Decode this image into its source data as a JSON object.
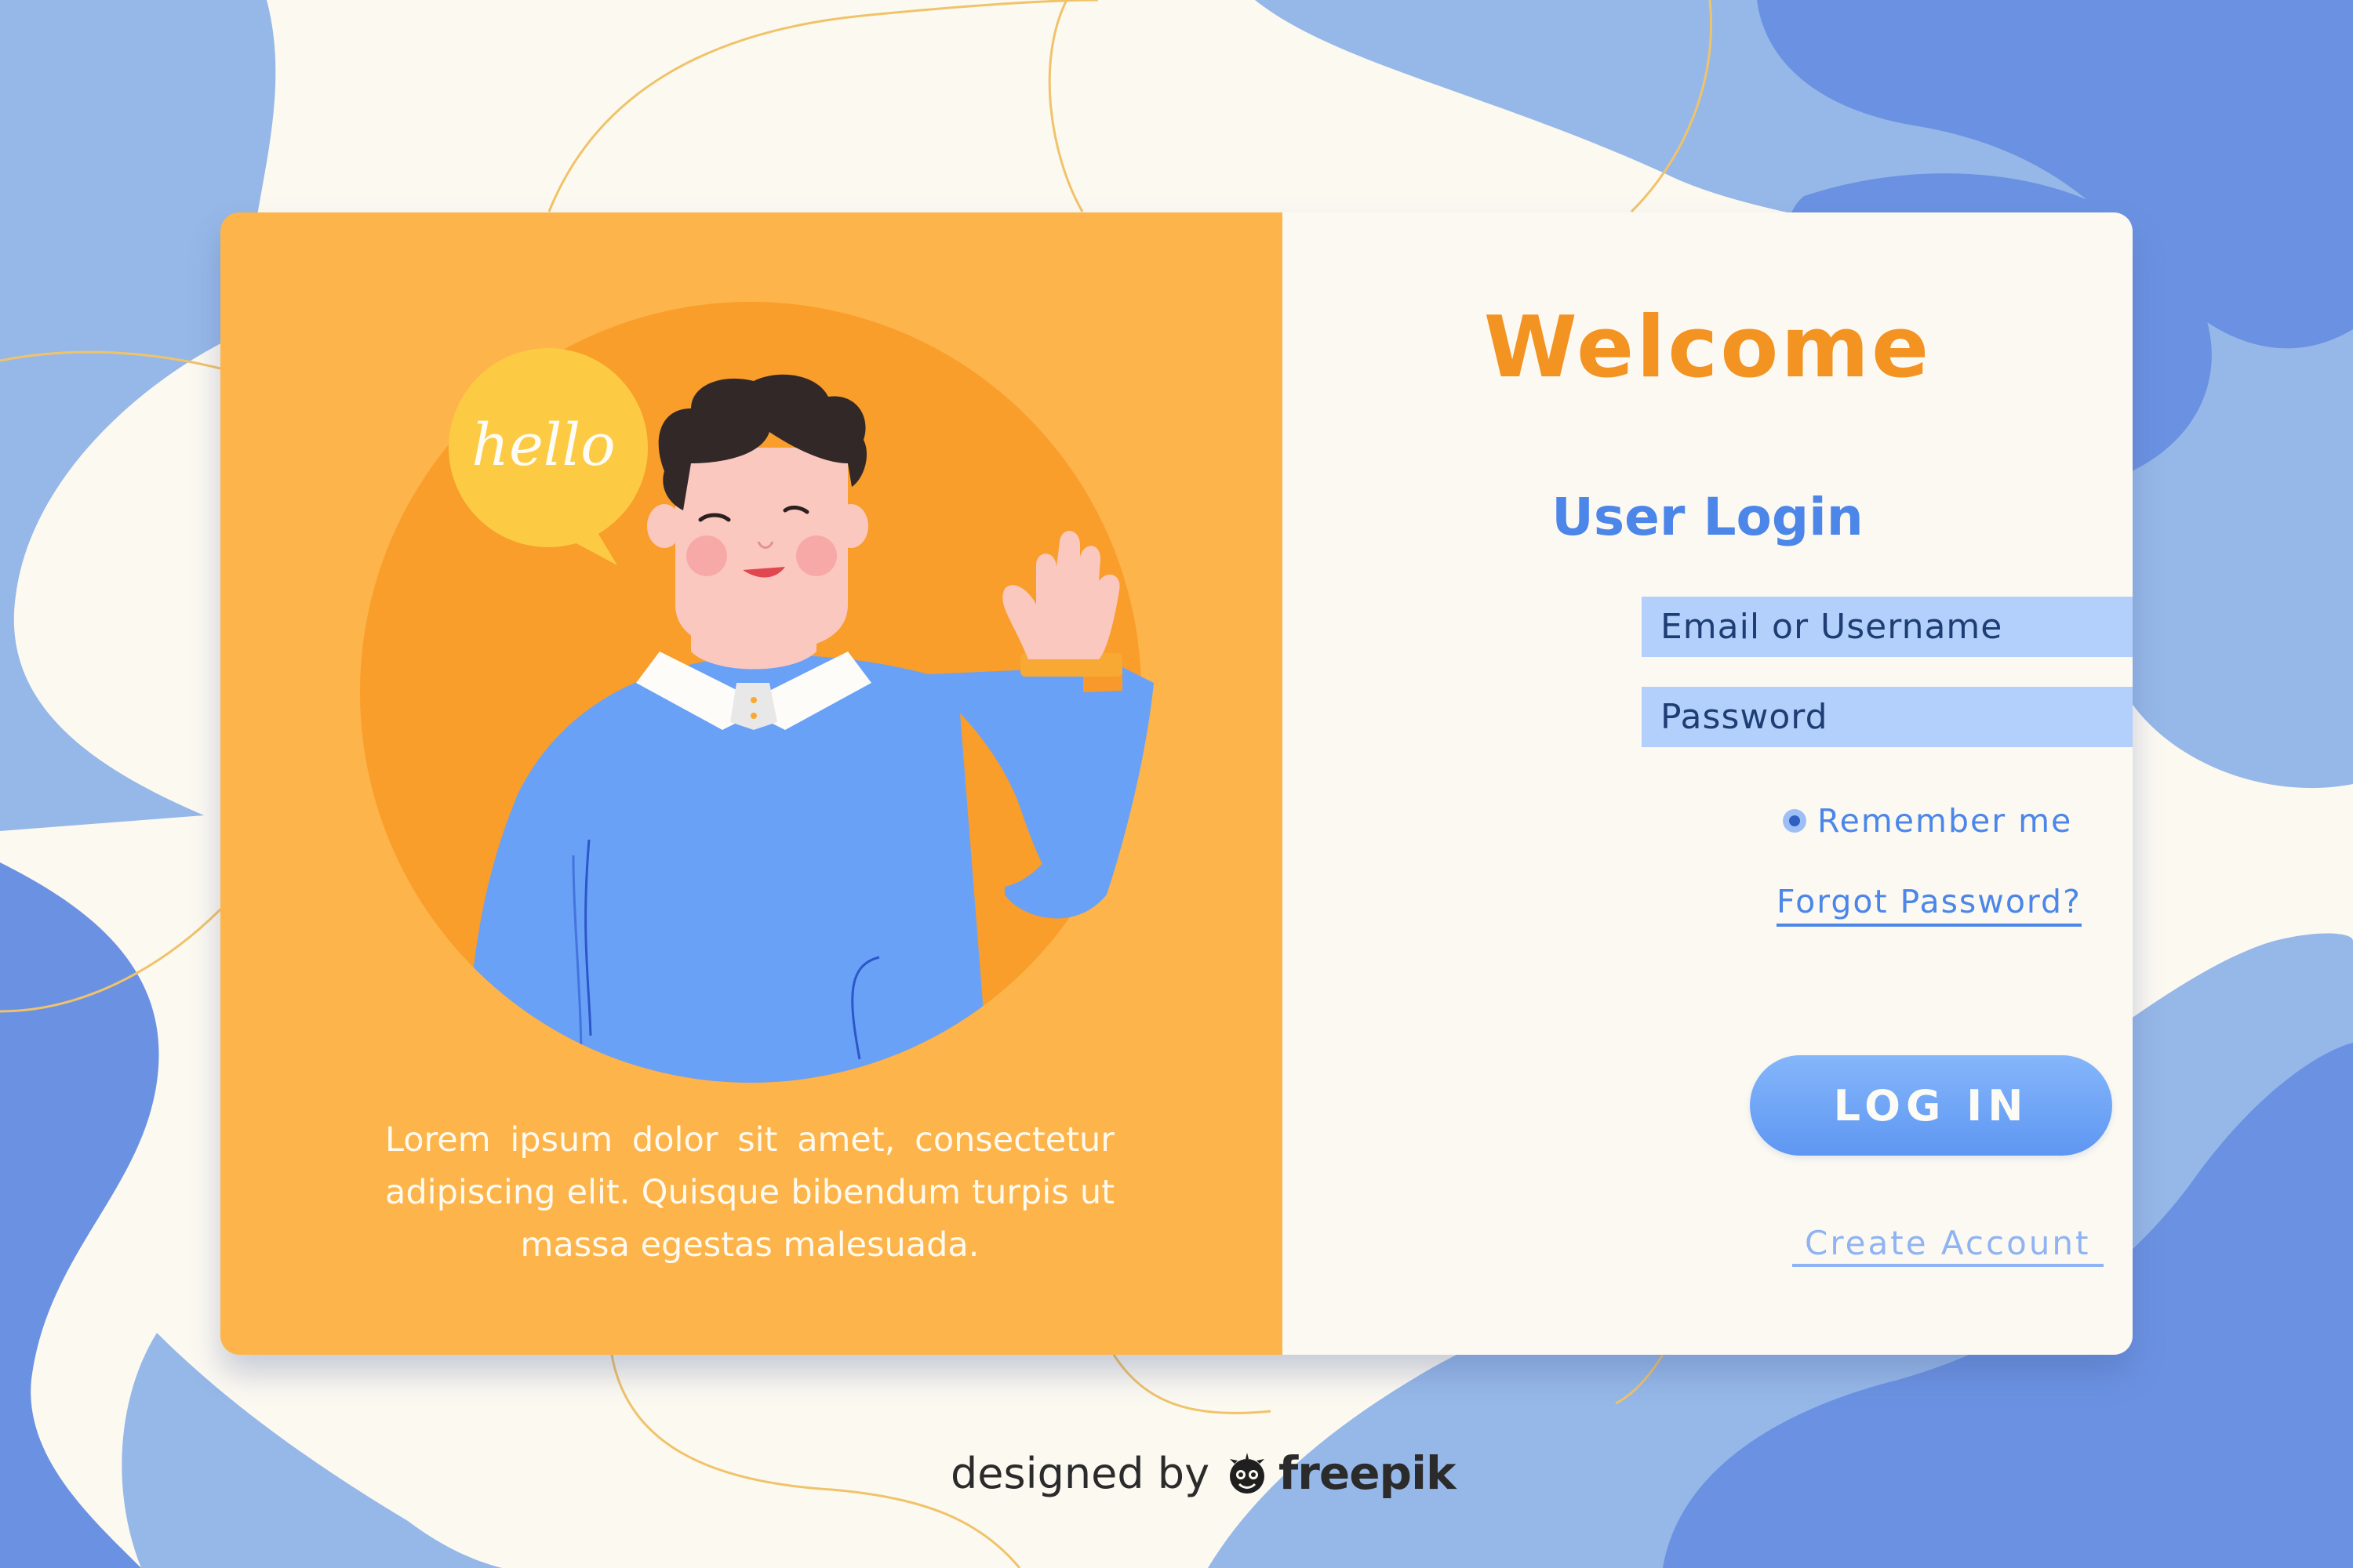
{
  "welcome": {
    "title": "Welcome",
    "subtitle": "User Login"
  },
  "form": {
    "email_placeholder": "Email or Username",
    "password_placeholder": "Password",
    "remember_label": "Remember me",
    "remember_checked": true,
    "forgot_label": "Forgot Password?",
    "login_label": "LOG IN",
    "create_label": "Create Account"
  },
  "illustration": {
    "speech_bubble": "hello",
    "description": "Lorem ipsum dolor sit amet, consectetur adipiscing elit. Quisque bibendum turpis ut massa egestas malesuada."
  },
  "footer": {
    "designed_by": "designed by",
    "brand": "freepik",
    "brand_icon": "freepik-logo-icon"
  },
  "colors": {
    "background": "#fcf9f1",
    "blob_light": "#96b8e8",
    "blob_dark": "#6b92e2",
    "panel_orange": "#fdb44a",
    "circle_orange": "#f99d2b",
    "welcome_orange": "#f39322",
    "accent_blue": "#4b86e8",
    "input_fill": "#b3cffb",
    "button_blue": "#6a9ff5"
  }
}
